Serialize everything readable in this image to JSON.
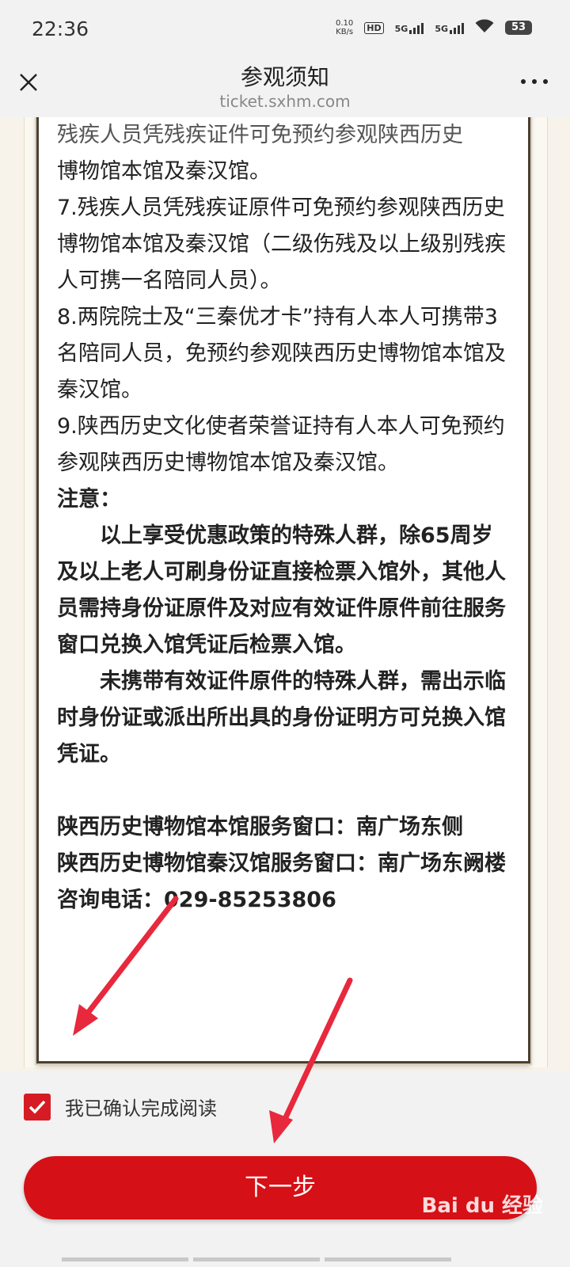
{
  "status_bar": {
    "time": "22:36",
    "net_speed_value": "0.10",
    "net_speed_unit": "KB/s",
    "hd_badge": "HD",
    "sim1_label": "5G",
    "sim2_label": "5G",
    "battery": "53"
  },
  "nav": {
    "title": "参观须知",
    "subtitle": "ticket.sxhm.com"
  },
  "content": {
    "clipped_line": "残疾人员凭残疾证件可免预约参观陕西历史",
    "line_6_end": "博物馆本馆及秦汉馆。",
    "item_7": "7.残疾人员凭残疾证原件可免预约参观陕西历史博物馆本馆及秦汉馆（二级伤残及以上级别残疾人可携一名陪同人员）。",
    "item_8": "8.两院院士及“三秦优才卡”持有人本人可携带3名陪同人员，免预约参观陕西历史博物馆本馆及秦汉馆。",
    "item_9": "9.陕西历史文化使者荣誉证持有人本人可免预约参观陕西历史博物馆本馆及秦汉馆。",
    "note_title": "注意：",
    "note_p1": "以上享受优惠政策的特殊人群，除65周岁及以上老人可刷身份证直接检票入馆外，其他人员需持身份证原件及对应有效证件原件前往服务窗口兑换入馆凭证后检票入馆。",
    "note_p2": "未携带有效证件原件的特殊人群，需出示临时身份证或派出所出具的身份证明方可兑换入馆凭证。",
    "service_1": "陕西历史博物馆本馆服务窗口：南广场东侧",
    "service_2": "陕西历史博物馆秦汉馆服务窗口：南广场东阙楼",
    "phone": "咨询电话：029-85253806"
  },
  "confirm": {
    "checked": true,
    "label": "我已确认完成阅读"
  },
  "next_button": {
    "label": "下一步"
  },
  "watermark": {
    "text": "Bai du 经验"
  },
  "colors": {
    "accent_red": "#d51016",
    "frame_border": "#4a4035",
    "annotation_arrow": "#e8283c"
  }
}
